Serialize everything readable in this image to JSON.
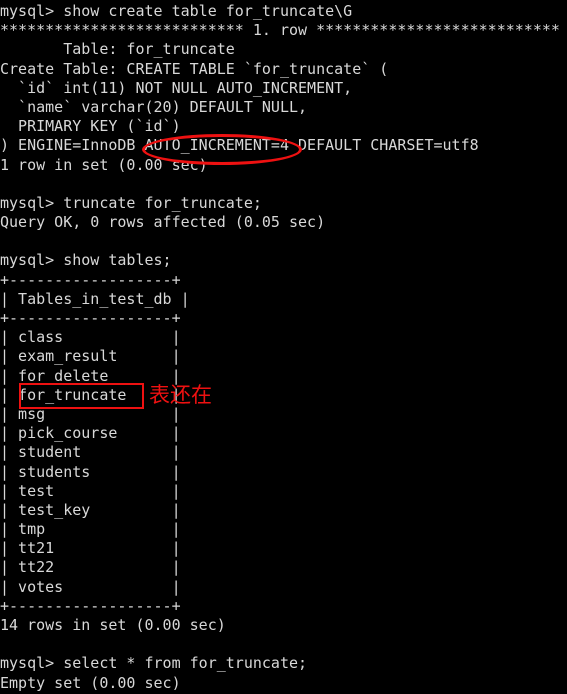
{
  "window": {
    "kind": "terminal",
    "title": "mysql client terminal",
    "background_color": "#000000",
    "text_color": "#d8d8d8",
    "annotation_color": "#ee1111",
    "columns": 61,
    "rows": 36
  },
  "session": {
    "prompt": "mysql>",
    "lines": [
      "mysql> show create table for_truncate\\G",
      "*************************** 1. row ***************************",
      "       Table: for_truncate",
      "Create Table: CREATE TABLE `for_truncate` (",
      "  `id` int(11) NOT NULL AUTO_INCREMENT,",
      "  `name` varchar(20) DEFAULT NULL,",
      "  PRIMARY KEY (`id`)",
      ") ENGINE=InnoDB AUTO_INCREMENT=4 DEFAULT CHARSET=utf8",
      "1 row in set (0.00 sec)",
      "",
      "mysql> truncate for_truncate;",
      "Query OK, 0 rows affected (0.05 sec)",
      "",
      "mysql> show tables;",
      "+------------------+",
      "| Tables_in_test_db |",
      "+------------------+",
      "| class            |",
      "| exam_result      |",
      "| for_delete       |",
      "| for_truncate     |",
      "| msg              |",
      "| pick_course      |",
      "| student          |",
      "| students         |",
      "| test             |",
      "| test_key         |",
      "| tmp              |",
      "| tt21             |",
      "| tt22             |",
      "| votes            |",
      "+------------------+",
      "14 rows in set (0.00 sec)",
      "",
      "mysql> select * from for_truncate;",
      "Empty set (0.00 sec)"
    ]
  },
  "commands": [
    {
      "index": 1,
      "text": "show create table for_truncate\\G",
      "result_header": "*************************** 1. row ***************************",
      "status": "1 row in set (0.00 sec)"
    },
    {
      "index": 2,
      "text": "truncate for_truncate;",
      "status": "Query OK, 0 rows affected (0.05 sec)"
    },
    {
      "index": 3,
      "text": "show tables;",
      "status": "14 rows in set (0.00 sec)"
    },
    {
      "index": 4,
      "text": "select * from for_truncate;",
      "status": "Empty set (0.00 sec)"
    }
  ],
  "create_table": {
    "table_name": "for_truncate",
    "statement_label": "Create Table:",
    "table_label": "Table:",
    "columns": [
      "`id` int(11) NOT NULL AUTO_INCREMENT,",
      "`name` varchar(20) DEFAULT NULL,",
      "PRIMARY KEY (`id`)"
    ],
    "options": ") ENGINE=InnoDB AUTO_INCREMENT=4 DEFAULT CHARSET=utf8",
    "engine": "InnoDB",
    "auto_increment": "4",
    "charset": "utf8"
  },
  "tables_result": {
    "column_header": "Tables_in_test_db",
    "border": "+------------------+",
    "rows": [
      "class",
      "exam_result",
      "for_delete",
      "for_truncate",
      "msg",
      "pick_course",
      "student",
      "students",
      "test",
      "test_key",
      "tmp",
      "tt21",
      "tt22",
      "votes"
    ],
    "row_count_text": "14 rows in set (0.00 sec)"
  },
  "annotations": {
    "ellipse": {
      "target_text": "AUTO_INCREMENT=4",
      "shape": "ellipse",
      "color": "#ee1111"
    },
    "rectangle": {
      "target_text": "for_truncate",
      "shape": "rectangle",
      "color": "#ee1111"
    },
    "note": {
      "text": "表还在",
      "color": "#ee1111"
    }
  }
}
